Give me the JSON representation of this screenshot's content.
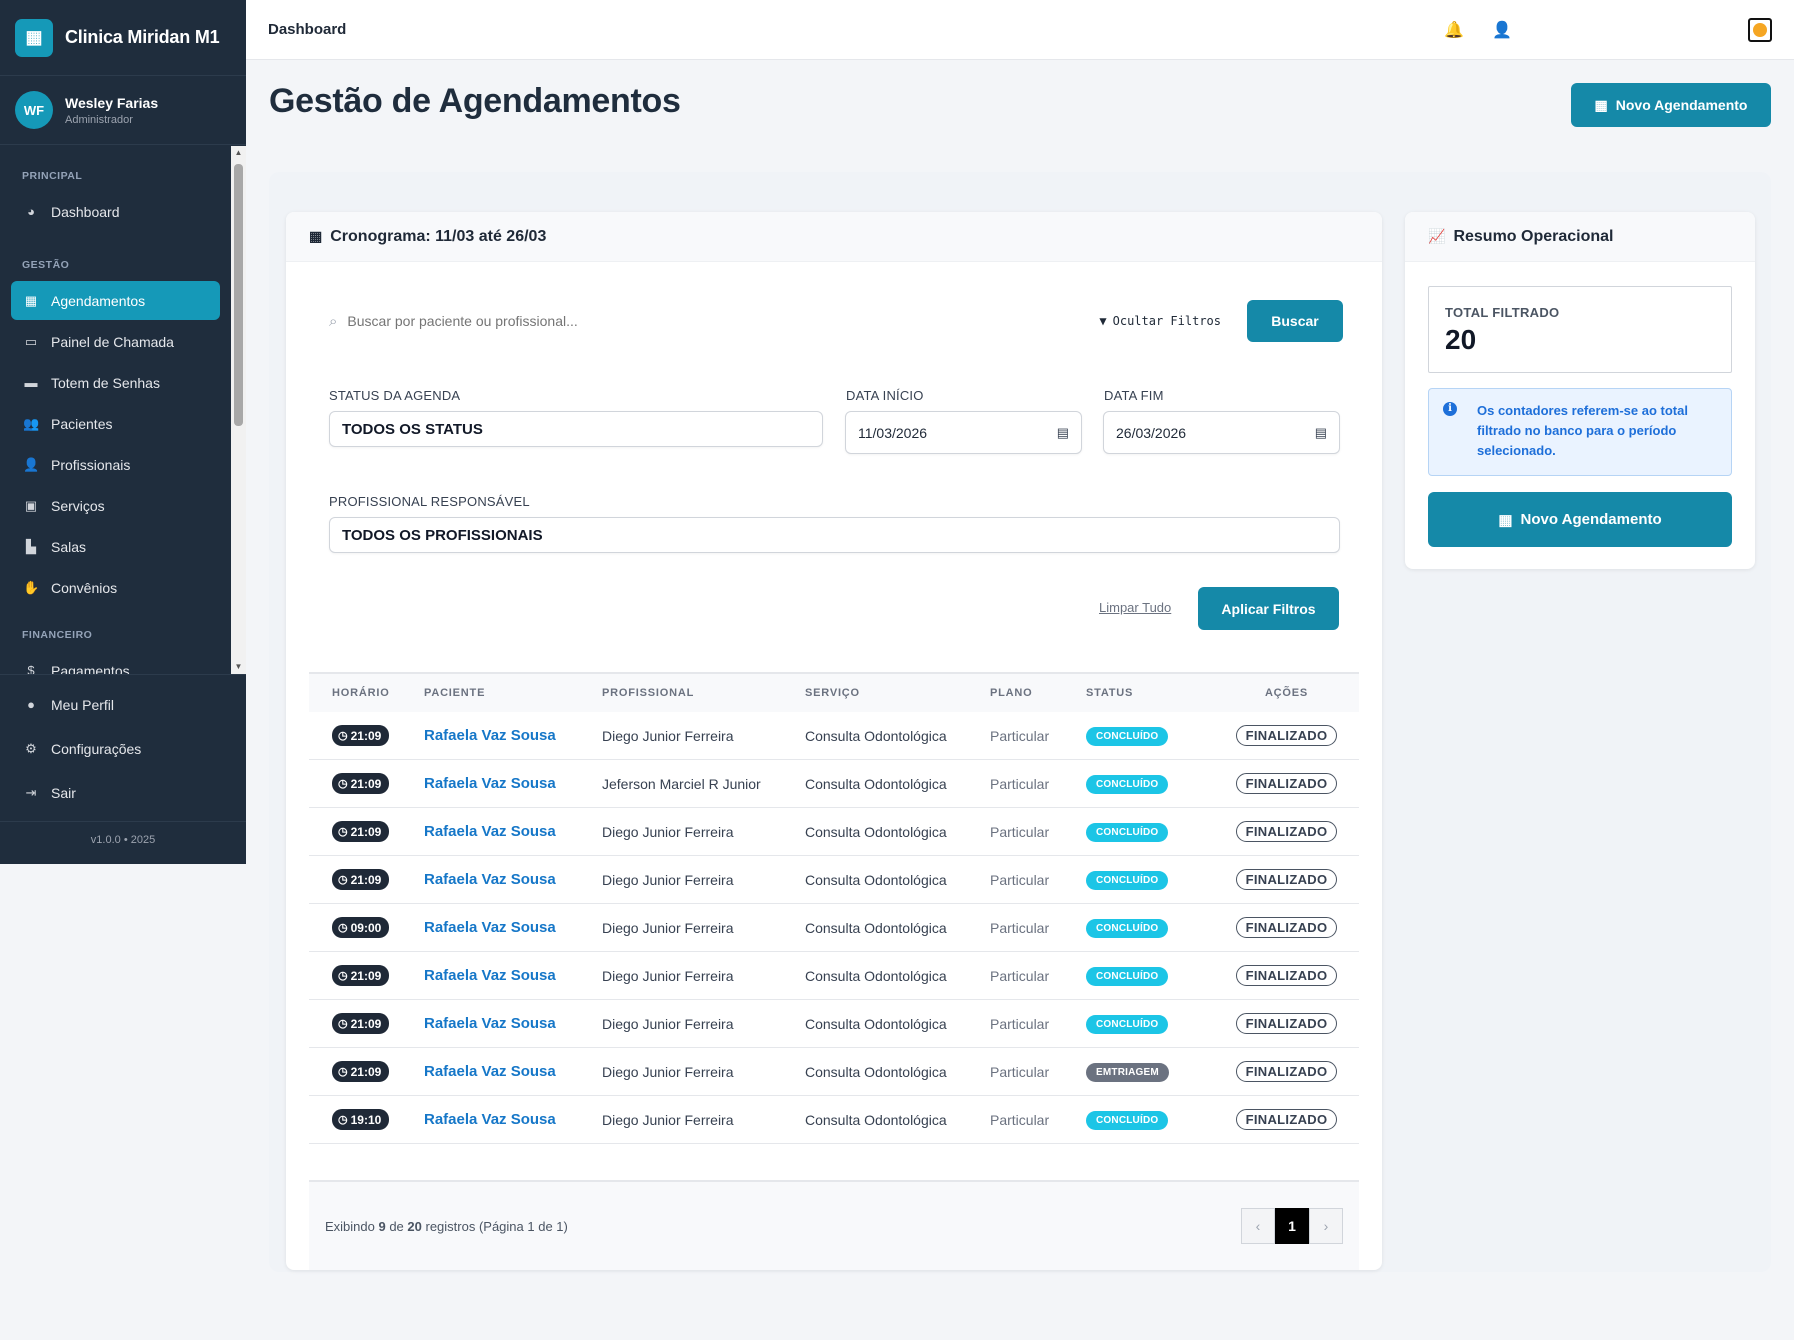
{
  "brand": {
    "name": "Clinica Miridan M1",
    "logo_text": "🏥"
  },
  "user": {
    "initials": "WF",
    "name": "Wesley Farias",
    "role": "Administrador"
  },
  "nav": {
    "section_principal": "PRINCIPAL",
    "section_gestao": "GESTÃO",
    "section_financeiro": "FINANCEIRO",
    "dashboard": "Dashboard",
    "agendamentos": "Agendamentos",
    "painel": "Painel de Chamada",
    "totem": "Totem de Senhas",
    "pacientes": "Pacientes",
    "profissionais": "Profissionais",
    "servicos": "Serviços",
    "salas": "Salas",
    "convenios": "Convênios",
    "pagamentos": "Pagamentos",
    "perfil": "Meu Perfil",
    "config": "Configurações",
    "sair": "Sair",
    "version": "v1.0.0 • 2025"
  },
  "topbar": {
    "title": "Dashboard"
  },
  "page": {
    "title": "Gestão de Agendamentos",
    "new_button": "Novo Agendamento"
  },
  "schedule": {
    "header": "Cronograma: 11/03 até 26/03",
    "search_placeholder": "Buscar por paciente ou profissional...",
    "toggle_filters": "Ocultar Filtros",
    "search_button": "Buscar",
    "status_label": "STATUS DA AGENDA",
    "status_value": "TODOS OS STATUS",
    "start_label": "DATA INÍCIO",
    "start_value": "11/03/2026",
    "end_label": "DATA FIM",
    "end_value": "26/03/2026",
    "prof_label": "PROFISSIONAL RESPONSÁVEL",
    "prof_value": "TODOS OS PROFISSIONAIS",
    "clear": "Limpar Tudo",
    "apply": "Aplicar Filtros"
  },
  "table": {
    "columns": [
      "HORÁRIO",
      "PACIENTE",
      "PROFISSIONAL",
      "SERVIÇO",
      "PLANO",
      "STATUS",
      "AÇÕES"
    ],
    "rows": [
      {
        "time": "21:09",
        "patient": "Rafaela Vaz Sousa",
        "professional": "Diego Junior Ferreira",
        "service": "Consulta Odontológica",
        "plan": "Particular",
        "status": "CONCLUÍDO",
        "action": "FINALIZADO"
      },
      {
        "time": "21:09",
        "patient": "Rafaela Vaz Sousa",
        "professional": "Jeferson Marciel R Junior",
        "service": "Consulta Odontológica",
        "plan": "Particular",
        "status": "CONCLUÍDO",
        "action": "FINALIZADO"
      },
      {
        "time": "21:09",
        "patient": "Rafaela Vaz Sousa",
        "professional": "Diego Junior Ferreira",
        "service": "Consulta Odontológica",
        "plan": "Particular",
        "status": "CONCLUÍDO",
        "action": "FINALIZADO"
      },
      {
        "time": "21:09",
        "patient": "Rafaela Vaz Sousa",
        "professional": "Diego Junior Ferreira",
        "service": "Consulta Odontológica",
        "plan": "Particular",
        "status": "CONCLUÍDO",
        "action": "FINALIZADO"
      },
      {
        "time": "09:00",
        "patient": "Rafaela Vaz Sousa",
        "professional": "Diego Junior Ferreira",
        "service": "Consulta Odontológica",
        "plan": "Particular",
        "status": "CONCLUÍDO",
        "action": "FINALIZADO"
      },
      {
        "time": "21:09",
        "patient": "Rafaela Vaz Sousa",
        "professional": "Diego Junior Ferreira",
        "service": "Consulta Odontológica",
        "plan": "Particular",
        "status": "CONCLUÍDO",
        "action": "FINALIZADO"
      },
      {
        "time": "21:09",
        "patient": "Rafaela Vaz Sousa",
        "professional": "Diego Junior Ferreira",
        "service": "Consulta Odontológica",
        "plan": "Particular",
        "status": "CONCLUÍDO",
        "action": "FINALIZADO"
      },
      {
        "time": "21:09",
        "patient": "Rafaela Vaz Sousa",
        "professional": "Diego Junior Ferreira",
        "service": "Consulta Odontológica",
        "plan": "Particular",
        "status": "EMTRIAGEM",
        "action": "FINALIZADO"
      },
      {
        "time": "19:10",
        "patient": "Rafaela Vaz Sousa",
        "professional": "Diego Junior Ferreira",
        "service": "Consulta Odontológica",
        "plan": "Particular",
        "status": "CONCLUÍDO",
        "action": "FINALIZADO"
      }
    ]
  },
  "footer": {
    "pre": "Exibindo ",
    "shown": "9",
    "mid": " de ",
    "total": "20",
    "post": " registros (Página 1 de 1)",
    "current_page": "1",
    "prev": "‹",
    "next": "›"
  },
  "summary": {
    "header": "Resumo Operacional",
    "total_label": "TOTAL FILTRADO",
    "total_value": "20",
    "info": "Os contadores referem-se ao total filtrado no banco para o período selecionado.",
    "new_button": "Novo Agendamento"
  },
  "colors": {
    "accent": "#1589a8",
    "sidebar": "#1f2d3d",
    "status_ok": "#1cc5e6",
    "status_triage": "#6b7280",
    "link": "#1677c8"
  }
}
